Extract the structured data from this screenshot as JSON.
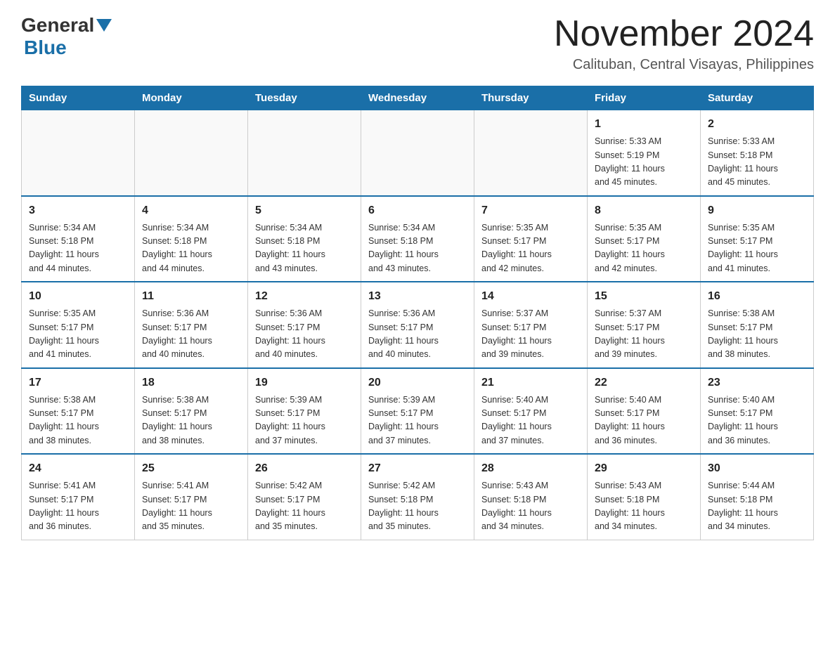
{
  "header": {
    "logo_general": "General",
    "logo_blue": "Blue",
    "month_title": "November 2024",
    "subtitle": "Calituban, Central Visayas, Philippines"
  },
  "days_of_week": [
    "Sunday",
    "Monday",
    "Tuesday",
    "Wednesday",
    "Thursday",
    "Friday",
    "Saturday"
  ],
  "weeks": [
    {
      "days": [
        {
          "num": "",
          "info": ""
        },
        {
          "num": "",
          "info": ""
        },
        {
          "num": "",
          "info": ""
        },
        {
          "num": "",
          "info": ""
        },
        {
          "num": "",
          "info": ""
        },
        {
          "num": "1",
          "info": "Sunrise: 5:33 AM\nSunset: 5:19 PM\nDaylight: 11 hours\nand 45 minutes."
        },
        {
          "num": "2",
          "info": "Sunrise: 5:33 AM\nSunset: 5:18 PM\nDaylight: 11 hours\nand 45 minutes."
        }
      ]
    },
    {
      "days": [
        {
          "num": "3",
          "info": "Sunrise: 5:34 AM\nSunset: 5:18 PM\nDaylight: 11 hours\nand 44 minutes."
        },
        {
          "num": "4",
          "info": "Sunrise: 5:34 AM\nSunset: 5:18 PM\nDaylight: 11 hours\nand 44 minutes."
        },
        {
          "num": "5",
          "info": "Sunrise: 5:34 AM\nSunset: 5:18 PM\nDaylight: 11 hours\nand 43 minutes."
        },
        {
          "num": "6",
          "info": "Sunrise: 5:34 AM\nSunset: 5:18 PM\nDaylight: 11 hours\nand 43 minutes."
        },
        {
          "num": "7",
          "info": "Sunrise: 5:35 AM\nSunset: 5:17 PM\nDaylight: 11 hours\nand 42 minutes."
        },
        {
          "num": "8",
          "info": "Sunrise: 5:35 AM\nSunset: 5:17 PM\nDaylight: 11 hours\nand 42 minutes."
        },
        {
          "num": "9",
          "info": "Sunrise: 5:35 AM\nSunset: 5:17 PM\nDaylight: 11 hours\nand 41 minutes."
        }
      ]
    },
    {
      "days": [
        {
          "num": "10",
          "info": "Sunrise: 5:35 AM\nSunset: 5:17 PM\nDaylight: 11 hours\nand 41 minutes."
        },
        {
          "num": "11",
          "info": "Sunrise: 5:36 AM\nSunset: 5:17 PM\nDaylight: 11 hours\nand 40 minutes."
        },
        {
          "num": "12",
          "info": "Sunrise: 5:36 AM\nSunset: 5:17 PM\nDaylight: 11 hours\nand 40 minutes."
        },
        {
          "num": "13",
          "info": "Sunrise: 5:36 AM\nSunset: 5:17 PM\nDaylight: 11 hours\nand 40 minutes."
        },
        {
          "num": "14",
          "info": "Sunrise: 5:37 AM\nSunset: 5:17 PM\nDaylight: 11 hours\nand 39 minutes."
        },
        {
          "num": "15",
          "info": "Sunrise: 5:37 AM\nSunset: 5:17 PM\nDaylight: 11 hours\nand 39 minutes."
        },
        {
          "num": "16",
          "info": "Sunrise: 5:38 AM\nSunset: 5:17 PM\nDaylight: 11 hours\nand 38 minutes."
        }
      ]
    },
    {
      "days": [
        {
          "num": "17",
          "info": "Sunrise: 5:38 AM\nSunset: 5:17 PM\nDaylight: 11 hours\nand 38 minutes."
        },
        {
          "num": "18",
          "info": "Sunrise: 5:38 AM\nSunset: 5:17 PM\nDaylight: 11 hours\nand 38 minutes."
        },
        {
          "num": "19",
          "info": "Sunrise: 5:39 AM\nSunset: 5:17 PM\nDaylight: 11 hours\nand 37 minutes."
        },
        {
          "num": "20",
          "info": "Sunrise: 5:39 AM\nSunset: 5:17 PM\nDaylight: 11 hours\nand 37 minutes."
        },
        {
          "num": "21",
          "info": "Sunrise: 5:40 AM\nSunset: 5:17 PM\nDaylight: 11 hours\nand 37 minutes."
        },
        {
          "num": "22",
          "info": "Sunrise: 5:40 AM\nSunset: 5:17 PM\nDaylight: 11 hours\nand 36 minutes."
        },
        {
          "num": "23",
          "info": "Sunrise: 5:40 AM\nSunset: 5:17 PM\nDaylight: 11 hours\nand 36 minutes."
        }
      ]
    },
    {
      "days": [
        {
          "num": "24",
          "info": "Sunrise: 5:41 AM\nSunset: 5:17 PM\nDaylight: 11 hours\nand 36 minutes."
        },
        {
          "num": "25",
          "info": "Sunrise: 5:41 AM\nSunset: 5:17 PM\nDaylight: 11 hours\nand 35 minutes."
        },
        {
          "num": "26",
          "info": "Sunrise: 5:42 AM\nSunset: 5:17 PM\nDaylight: 11 hours\nand 35 minutes."
        },
        {
          "num": "27",
          "info": "Sunrise: 5:42 AM\nSunset: 5:18 PM\nDaylight: 11 hours\nand 35 minutes."
        },
        {
          "num": "28",
          "info": "Sunrise: 5:43 AM\nSunset: 5:18 PM\nDaylight: 11 hours\nand 34 minutes."
        },
        {
          "num": "29",
          "info": "Sunrise: 5:43 AM\nSunset: 5:18 PM\nDaylight: 11 hours\nand 34 minutes."
        },
        {
          "num": "30",
          "info": "Sunrise: 5:44 AM\nSunset: 5:18 PM\nDaylight: 11 hours\nand 34 minutes."
        }
      ]
    }
  ]
}
